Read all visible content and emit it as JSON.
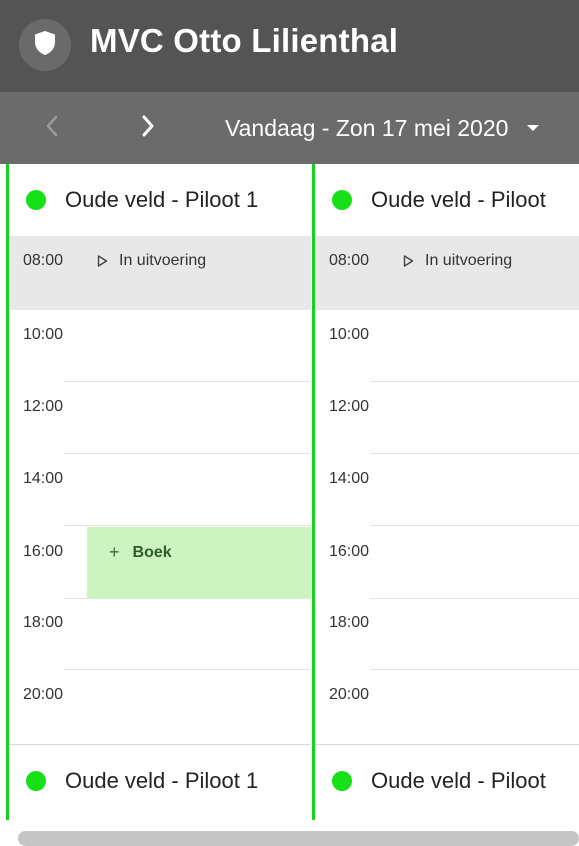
{
  "header": {
    "title": "MVC Otto Lilienthal",
    "logo_icon": "shield-icon"
  },
  "nav": {
    "prev_icon": "chevron-left-icon",
    "next_icon": "chevron-right-icon",
    "date_label": "Vandaag - Zon 17 mei 2020",
    "dropdown_icon": "caret-down-icon"
  },
  "columns": [
    {
      "title": "Oude veld - Piloot 1",
      "footer_title": "Oude veld - Piloot 1",
      "status_color": "#16e016",
      "times": [
        "08:00",
        "10:00",
        "12:00",
        "14:00",
        "16:00",
        "18:00",
        "20:00"
      ],
      "active_status": "In uitvoering",
      "booking_label": "Boek"
    },
    {
      "title": "Oude veld - Piloot",
      "footer_title": "Oude veld - Piloot",
      "status_color": "#16e016",
      "times": [
        "08:00",
        "10:00",
        "12:00",
        "14:00",
        "16:00",
        "18:00",
        "20:00"
      ],
      "active_status": "In uitvoering"
    }
  ],
  "colors": {
    "header_bg": "#545454",
    "nav_bg": "#6b6b6b",
    "column_accent": "#19d11f",
    "booking_bg": "#ccf3c0"
  }
}
